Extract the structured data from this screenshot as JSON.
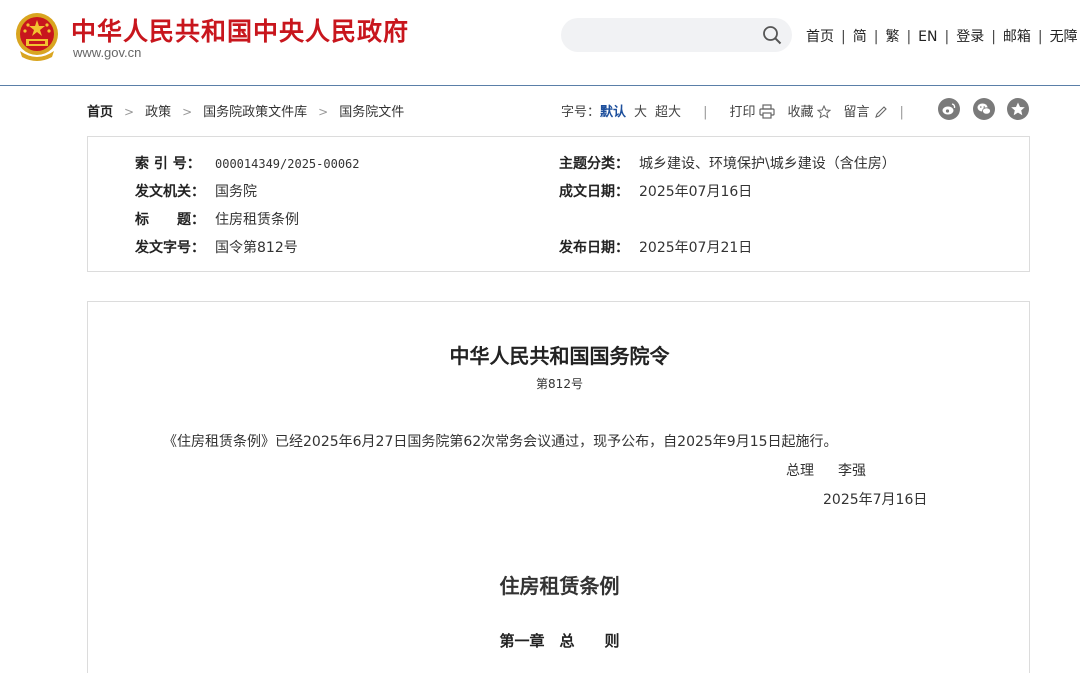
{
  "header": {
    "site_title": "中华人民共和国中央人民政府",
    "site_url": "www.gov.cn",
    "search_placeholder": "",
    "links": [
      "首页",
      "简",
      "繁",
      "EN",
      "登录",
      "邮箱",
      "无障"
    ]
  },
  "breadcrumb": {
    "items": [
      "首页",
      "政策",
      "国务院政策文件库",
      "国务院文件"
    ]
  },
  "tools": {
    "font_label": "字号：",
    "font_default": "默认",
    "font_large": "大",
    "font_xlarge": "超大",
    "print": "打印",
    "favorite": "收藏",
    "comment": "留言"
  },
  "share": [
    "weibo-icon",
    "wechat-icon",
    "star-icon"
  ],
  "meta": {
    "index_no_label": "索 引 号：",
    "index_no": "000014349/2025-00062",
    "issuer_label": "发文机关：",
    "issuer": "国务院",
    "title_label": "标　　题：",
    "title": "住房租赁条例",
    "doc_no_label": "发文字号：",
    "doc_no": "国令第812号",
    "topic_label": "主题分类：",
    "topic": "城乡建设、环境保护\\城乡建设（含住房）",
    "created_label": "成文日期：",
    "created": "2025年07月16日",
    "published_label": "发布日期：",
    "published": "2025年07月21日"
  },
  "article": {
    "title": "中华人民共和国国务院令",
    "number": "第812号",
    "body": "《住房租赁条例》已经2025年6月27日国务院第62次常务会议通过，现予公布，自2025年9月15日起施行。",
    "signer_title": "总理",
    "signer_name": "李强",
    "sign_date": "2025年7月16日",
    "law_title": "住房租赁条例",
    "chapter": "第一章　总　　则"
  },
  "colors": {
    "brand_red": "#c8161d",
    "active_blue": "#1d4f9c"
  }
}
